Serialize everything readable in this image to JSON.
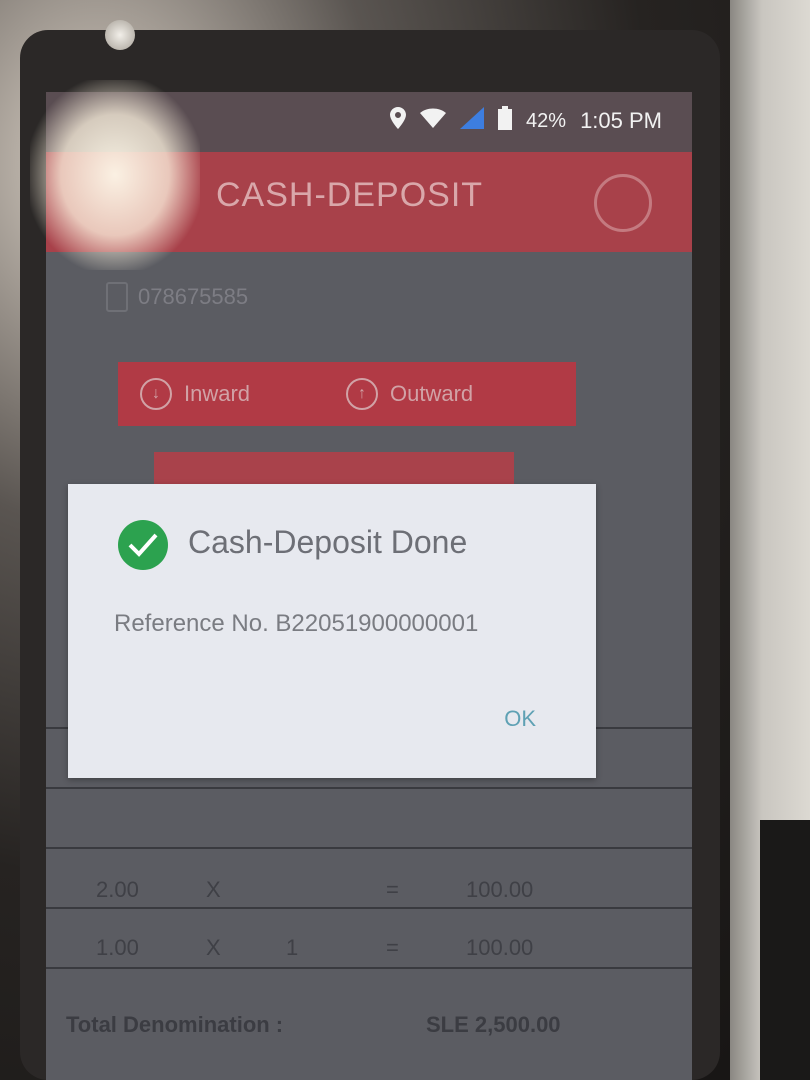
{
  "status_bar": {
    "battery_percent": "42%",
    "time": "1:05 PM"
  },
  "header": {
    "title": "CASH-DEPOSIT"
  },
  "account": {
    "number": "078675585"
  },
  "actions": {
    "inward_label": "Inward",
    "outward_label": "Outward"
  },
  "denominations": [
    {
      "value": "2.00",
      "op": "X",
      "count": "",
      "eq": "=",
      "amount": "100.00"
    },
    {
      "value": "1.00",
      "op": "X",
      "count": "1",
      "eq": "=",
      "amount": "100.00"
    }
  ],
  "total": {
    "label": "Total Denomination :",
    "value": "SLE 2,500.00"
  },
  "dialog": {
    "title": "Cash-Deposit Done",
    "message": "Reference No. B22051900000001",
    "ok_label": "OK"
  },
  "colors": {
    "header_red": "#a8414a",
    "success_green": "#2ca24f",
    "ok_link": "#5fa1b4"
  }
}
